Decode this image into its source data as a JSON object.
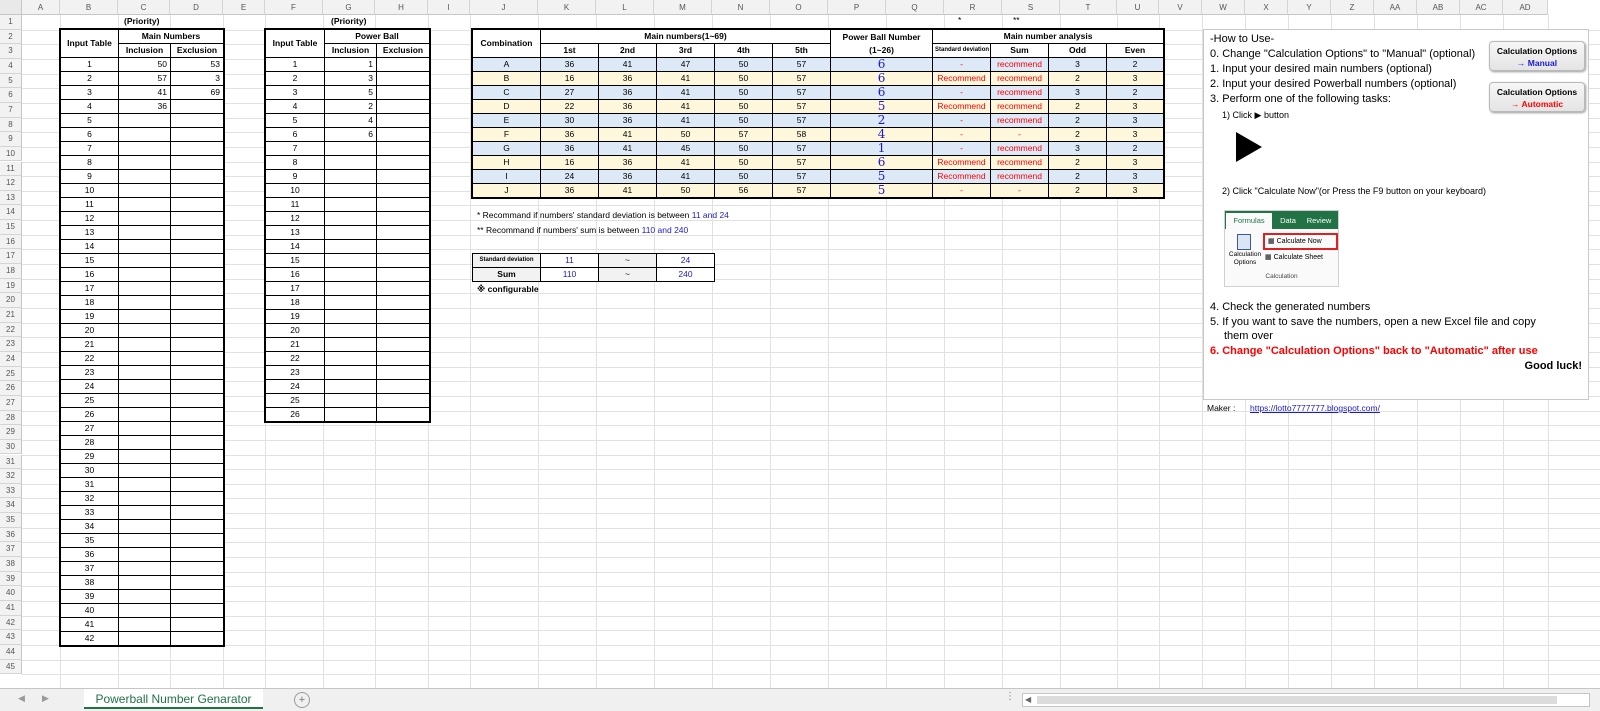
{
  "columns": [
    "A",
    "B",
    "C",
    "D",
    "E",
    "F",
    "G",
    "H",
    "I",
    "J",
    "K",
    "L",
    "M",
    "N",
    "O",
    "P",
    "Q",
    "R",
    "S",
    "T",
    "U",
    "V",
    "W",
    "X",
    "Y",
    "Z",
    "AA",
    "AB",
    "AC",
    "AD"
  ],
  "rows": [
    "1",
    "2",
    "3",
    "4",
    "5",
    "6",
    "7",
    "8",
    "9",
    "10",
    "11",
    "12",
    "13",
    "14",
    "15",
    "16",
    "17",
    "18",
    "19",
    "20",
    "21",
    "22",
    "23",
    "24",
    "25",
    "26",
    "27",
    "28",
    "29",
    "30",
    "31",
    "32",
    "33",
    "34",
    "35",
    "36",
    "37",
    "38",
    "39",
    "40",
    "41",
    "42",
    "43",
    "44",
    "45"
  ],
  "header_marks": {
    "priority_main": "(Priority)",
    "priority_pb": "(Priority)",
    "q_mark": "*",
    "r_mark": "**"
  },
  "main_input": {
    "title": "Input Table",
    "group": "Main Numbers",
    "inclusion": "Inclusion",
    "exclusion": "Exclusion",
    "rows": [
      {
        "n": "1",
        "inc": "50",
        "exc": "53"
      },
      {
        "n": "2",
        "inc": "57",
        "exc": "3"
      },
      {
        "n": "3",
        "inc": "41",
        "exc": "69"
      },
      {
        "n": "4",
        "inc": "36",
        "exc": ""
      },
      {
        "n": "5",
        "inc": "",
        "exc": ""
      },
      {
        "n": "6",
        "inc": "",
        "exc": ""
      },
      {
        "n": "7",
        "inc": "",
        "exc": ""
      },
      {
        "n": "8",
        "inc": "",
        "exc": ""
      },
      {
        "n": "9",
        "inc": "",
        "exc": ""
      },
      {
        "n": "10",
        "inc": "",
        "exc": ""
      },
      {
        "n": "11",
        "inc": "",
        "exc": ""
      },
      {
        "n": "12",
        "inc": "",
        "exc": ""
      },
      {
        "n": "13",
        "inc": "",
        "exc": ""
      },
      {
        "n": "14",
        "inc": "",
        "exc": ""
      },
      {
        "n": "15",
        "inc": "",
        "exc": ""
      },
      {
        "n": "16",
        "inc": "",
        "exc": ""
      },
      {
        "n": "17",
        "inc": "",
        "exc": ""
      },
      {
        "n": "18",
        "inc": "",
        "exc": ""
      },
      {
        "n": "19",
        "inc": "",
        "exc": ""
      },
      {
        "n": "20",
        "inc": "",
        "exc": ""
      },
      {
        "n": "21",
        "inc": "",
        "exc": ""
      },
      {
        "n": "22",
        "inc": "",
        "exc": ""
      },
      {
        "n": "23",
        "inc": "",
        "exc": ""
      },
      {
        "n": "24",
        "inc": "",
        "exc": ""
      },
      {
        "n": "25",
        "inc": "",
        "exc": ""
      },
      {
        "n": "26",
        "inc": "",
        "exc": ""
      },
      {
        "n": "27",
        "inc": "",
        "exc": ""
      },
      {
        "n": "28",
        "inc": "",
        "exc": ""
      },
      {
        "n": "29",
        "inc": "",
        "exc": ""
      },
      {
        "n": "30",
        "inc": "",
        "exc": ""
      },
      {
        "n": "31",
        "inc": "",
        "exc": ""
      },
      {
        "n": "32",
        "inc": "",
        "exc": ""
      },
      {
        "n": "33",
        "inc": "",
        "exc": ""
      },
      {
        "n": "34",
        "inc": "",
        "exc": ""
      },
      {
        "n": "35",
        "inc": "",
        "exc": ""
      },
      {
        "n": "36",
        "inc": "",
        "exc": ""
      },
      {
        "n": "37",
        "inc": "",
        "exc": ""
      },
      {
        "n": "38",
        "inc": "",
        "exc": ""
      },
      {
        "n": "39",
        "inc": "",
        "exc": ""
      },
      {
        "n": "40",
        "inc": "",
        "exc": ""
      },
      {
        "n": "41",
        "inc": "",
        "exc": ""
      },
      {
        "n": "42",
        "inc": "",
        "exc": ""
      }
    ]
  },
  "pb_input": {
    "title": "Input Table",
    "group": "Power Ball",
    "inclusion": "Inclusion",
    "exclusion": "Exclusion",
    "rows": [
      {
        "n": "1",
        "inc": "1",
        "exc": ""
      },
      {
        "n": "2",
        "inc": "3",
        "exc": ""
      },
      {
        "n": "3",
        "inc": "5",
        "exc": ""
      },
      {
        "n": "4",
        "inc": "2",
        "exc": ""
      },
      {
        "n": "5",
        "inc": "4",
        "exc": ""
      },
      {
        "n": "6",
        "inc": "6",
        "exc": ""
      },
      {
        "n": "7",
        "inc": "",
        "exc": ""
      },
      {
        "n": "8",
        "inc": "",
        "exc": ""
      },
      {
        "n": "9",
        "inc": "",
        "exc": ""
      },
      {
        "n": "10",
        "inc": "",
        "exc": ""
      },
      {
        "n": "11",
        "inc": "",
        "exc": ""
      },
      {
        "n": "12",
        "inc": "",
        "exc": ""
      },
      {
        "n": "13",
        "inc": "",
        "exc": ""
      },
      {
        "n": "14",
        "inc": "",
        "exc": ""
      },
      {
        "n": "15",
        "inc": "",
        "exc": ""
      },
      {
        "n": "16",
        "inc": "",
        "exc": ""
      },
      {
        "n": "17",
        "inc": "",
        "exc": ""
      },
      {
        "n": "18",
        "inc": "",
        "exc": ""
      },
      {
        "n": "19",
        "inc": "",
        "exc": ""
      },
      {
        "n": "20",
        "inc": "",
        "exc": ""
      },
      {
        "n": "21",
        "inc": "",
        "exc": ""
      },
      {
        "n": "22",
        "inc": "",
        "exc": ""
      },
      {
        "n": "23",
        "inc": "",
        "exc": ""
      },
      {
        "n": "24",
        "inc": "",
        "exc": ""
      },
      {
        "n": "25",
        "inc": "",
        "exc": ""
      },
      {
        "n": "26",
        "inc": "",
        "exc": ""
      }
    ]
  },
  "combos": {
    "h_combination": "Combination",
    "h_main": "Main numbers(1~69)",
    "h_pb": "Power Ball Number",
    "h_pb_range": "(1~26)",
    "h_analysis": "Main number analysis",
    "h_1st": "1st",
    "h_2nd": "2nd",
    "h_3rd": "3rd",
    "h_4th": "4th",
    "h_5th": "5th",
    "h_sd": "Standard deviation",
    "h_sum": "Sum",
    "h_odd": "Odd",
    "h_even": "Even",
    "rows": [
      {
        "id": "A",
        "n1": "36",
        "n2": "41",
        "n3": "47",
        "n4": "50",
        "n5": "57",
        "pb": "6",
        "sd": "-",
        "sum": "recommend",
        "odd": "3",
        "even": "2"
      },
      {
        "id": "B",
        "n1": "16",
        "n2": "36",
        "n3": "41",
        "n4": "50",
        "n5": "57",
        "pb": "6",
        "sd": "Recommend",
        "sum": "recommend",
        "odd": "2",
        "even": "3"
      },
      {
        "id": "C",
        "n1": "27",
        "n2": "36",
        "n3": "41",
        "n4": "50",
        "n5": "57",
        "pb": "6",
        "sd": "-",
        "sum": "recommend",
        "odd": "3",
        "even": "2"
      },
      {
        "id": "D",
        "n1": "22",
        "n2": "36",
        "n3": "41",
        "n4": "50",
        "n5": "57",
        "pb": "5",
        "sd": "Recommend",
        "sum": "recommend",
        "odd": "2",
        "even": "3"
      },
      {
        "id": "E",
        "n1": "30",
        "n2": "36",
        "n3": "41",
        "n4": "50",
        "n5": "57",
        "pb": "2",
        "sd": "-",
        "sum": "recommend",
        "odd": "2",
        "even": "3"
      },
      {
        "id": "F",
        "n1": "36",
        "n2": "41",
        "n3": "50",
        "n4": "57",
        "n5": "58",
        "pb": "4",
        "sd": "-",
        "sum": "-",
        "odd": "2",
        "even": "3"
      },
      {
        "id": "G",
        "n1": "36",
        "n2": "41",
        "n3": "45",
        "n4": "50",
        "n5": "57",
        "pb": "1",
        "sd": "-",
        "sum": "recommend",
        "odd": "3",
        "even": "2"
      },
      {
        "id": "H",
        "n1": "16",
        "n2": "36",
        "n3": "41",
        "n4": "50",
        "n5": "57",
        "pb": "6",
        "sd": "Recommend",
        "sum": "recommend",
        "odd": "2",
        "even": "3"
      },
      {
        "id": "I",
        "n1": "24",
        "n2": "36",
        "n3": "41",
        "n4": "50",
        "n5": "57",
        "pb": "5",
        "sd": "Recommend",
        "sum": "recommend",
        "odd": "2",
        "even": "3"
      },
      {
        "id": "J",
        "n1": "36",
        "n2": "41",
        "n3": "50",
        "n4": "56",
        "n5": "57",
        "pb": "5",
        "sd": "-",
        "sum": "-",
        "odd": "2",
        "even": "3"
      }
    ]
  },
  "notes": {
    "sd_prefix": "* Recommand if numbers' standard deviation is between ",
    "sd_range": "11 and 24",
    "sum_prefix": "** Recommand if numbers' sum is between ",
    "sum_range": "110 and 240",
    "configurable": "※ configurable"
  },
  "config": {
    "sd_label": "Standard deviation",
    "sd_min": "11",
    "sd_tilde": "~",
    "sd_max": "24",
    "sum_label": "Sum",
    "sum_min": "110",
    "sum_tilde": "~",
    "sum_max": "240"
  },
  "howto": {
    "title": "-How to Use-",
    "step0": "0. Change \"Calculation Options\" to \"Manual\" (optional)",
    "step1": "1. Input your desired main numbers (optional)",
    "step2": "2. Input your desired Powerball numbers (optional)",
    "step3": "3. Perform one of the following tasks:",
    "sub1_pre": "1) Click",
    "sub1_post": "button",
    "sub2": "2) Click \"Calculate Now\"(or Press the F9 button on your keyboard)",
    "step4": "4. Check the generated numbers",
    "step5a": "5. If you want to save the numbers, open a new Excel file and copy",
    "step5b": "them over",
    "step6": "6. Change \"Calculation Options\" back to \"Automatic\" after use",
    "goodluck": "Good luck!",
    "btn_manual_l1": "Calculation Options",
    "btn_manual_l2": "→ Manual",
    "btn_auto_l1": "Calculation Options",
    "btn_auto_l2": "→ Automatic",
    "ribbon_tab_formulas": "Formulas",
    "ribbon_tab_data": "Data",
    "ribbon_tab_review": "Review",
    "ribbon_calc_now": "Calculate Now",
    "ribbon_calc_sheet": "Calculate Sheet",
    "ribbon_calc_options": "Calculation Options",
    "ribbon_group": "Calculation"
  },
  "maker": {
    "label": "Maker :",
    "url": "https://lotto7777777.blogspot.com/"
  },
  "sheet_tab": "Powerball Number Genarator",
  "colors": {
    "accent_green": "#217346",
    "pb_blue": "#1a1ad6",
    "recommend_red": "#ff0000",
    "band_blue": "#dde9f7",
    "band_yellow": "#fff7dc"
  }
}
